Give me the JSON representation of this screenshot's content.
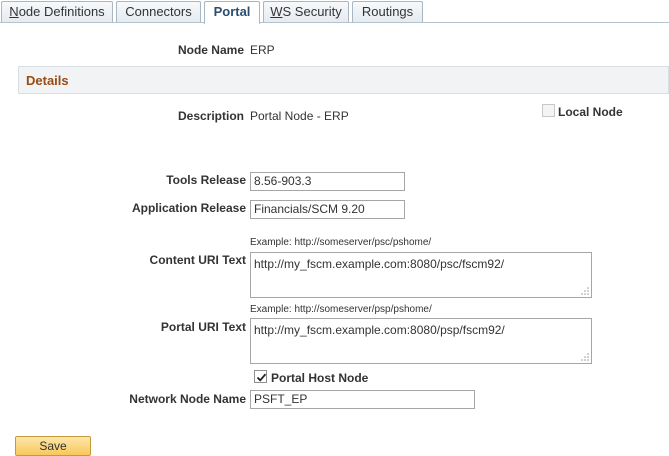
{
  "tabs": [
    {
      "label": "Node Definitions",
      "access_key": "N",
      "rest": "ode Definitions"
    },
    {
      "label": "Connectors",
      "access_key": "",
      "rest": "Connectors"
    },
    {
      "label": "Portal",
      "access_key": "",
      "rest": "Portal"
    },
    {
      "label": "WS Security",
      "access_key": "W",
      "rest": "S Security"
    },
    {
      "label": "Routings",
      "access_key": "",
      "rest": "Routings"
    }
  ],
  "active_tab": "Portal",
  "node_name": {
    "label": "Node Name",
    "value": "ERP"
  },
  "details": {
    "title": "Details"
  },
  "description": {
    "label": "Description",
    "value": "Portal Node - ERP"
  },
  "local_node": {
    "label": "Local Node",
    "checked": false,
    "enabled": false
  },
  "tools_release": {
    "label": "Tools Release",
    "value": "8.56-903.3"
  },
  "application_release": {
    "label": "Application Release",
    "value": "Financials/SCM 9.20"
  },
  "content_uri": {
    "example": "Example: http://someserver/psc/pshome/",
    "label": "Content URI Text",
    "value": "http://my_fscm.example.com:8080/psc/fscm92/"
  },
  "portal_uri": {
    "example": "Example: http://someserver/psp/pshome/",
    "label": "Portal URI Text",
    "value": "http://my_fscm.example.com:8080/psp/fscm92/"
  },
  "portal_host_node": {
    "label": "Portal Host Node",
    "checked": true
  },
  "network_node_name": {
    "label": "Network Node Name",
    "value": "PSFT_EP"
  },
  "save_button": {
    "label": "Save"
  },
  "colors": {
    "details_title": "#9b4c12",
    "save_button": "#f7c85a",
    "active_tab_text": "#2b4e6e"
  }
}
